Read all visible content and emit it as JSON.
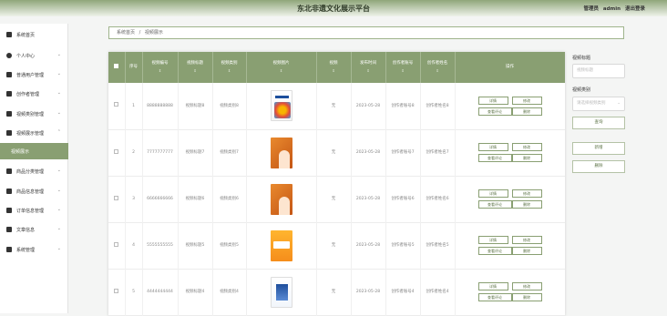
{
  "header": {
    "title": "东北非遗文化展示平台",
    "role": "管理员",
    "username": "admin",
    "logout": "退出登录"
  },
  "sidebar": {
    "items": [
      {
        "label": "系统首页",
        "icon": "home-icon",
        "chevron": ""
      },
      {
        "label": "个人中心",
        "icon": "user-icon",
        "chevron": "⌄"
      },
      {
        "label": "普通用户管理",
        "icon": "users-icon",
        "chevron": "⌄"
      },
      {
        "label": "创作者管理",
        "icon": "edit-icon",
        "chevron": "⌄"
      },
      {
        "label": "视频类别管理",
        "icon": "flag-icon",
        "chevron": "⌄"
      },
      {
        "label": "视频展示管理",
        "icon": "video-icon",
        "chevron": "⌃"
      },
      {
        "label": "视频展示",
        "icon": "",
        "chevron": ""
      },
      {
        "label": "商品分类管理",
        "icon": "grid-icon",
        "chevron": "⌄"
      },
      {
        "label": "商品信息管理",
        "icon": "bar-chart-icon",
        "chevron": "⌄"
      },
      {
        "label": "订单信息管理",
        "icon": "cart-icon",
        "chevron": "⌄"
      },
      {
        "label": "文章信息",
        "icon": "grid-icon",
        "chevron": "⌄"
      },
      {
        "label": "系统管理",
        "icon": "grid-icon",
        "chevron": "⌄"
      }
    ]
  },
  "breadcrumb": {
    "home": "系统首页",
    "sep": "/",
    "current": "视频展示"
  },
  "table": {
    "headers": [
      "序号",
      "视频编号",
      "视频标题",
      "视频类别",
      "视频图片",
      "视频",
      "发布时间",
      "创作者账号",
      "创作者姓名",
      "操作"
    ],
    "sort_mark": "⇕",
    "rows": [
      {
        "idx": "1",
        "code": "8888888888",
        "title": "视频标题8",
        "category": "视频类别8",
        "video": "无",
        "time": "2023-05-28",
        "account": "创作者账号8",
        "name": "创作者姓名8",
        "cover": "c0"
      },
      {
        "idx": "2",
        "code": "7777777777",
        "title": "视频标题7",
        "category": "视频类别7",
        "video": "无",
        "time": "2023-05-28",
        "account": "创作者账号7",
        "name": "创作者姓名7",
        "cover": "c1"
      },
      {
        "idx": "3",
        "code": "6666666666",
        "title": "视频标题6",
        "category": "视频类别6",
        "video": "无",
        "time": "2023-05-28",
        "account": "创作者账号6",
        "name": "创作者姓名6",
        "cover": "c1"
      },
      {
        "idx": "4",
        "code": "5555555555",
        "title": "视频标题5",
        "category": "视频类别5",
        "video": "无",
        "time": "2023-05-28",
        "account": "创作者账号5",
        "name": "创作者姓名5",
        "cover": "c3"
      },
      {
        "idx": "5",
        "code": "4444444444",
        "title": "视频标题4",
        "category": "视频类别4",
        "video": "无",
        "time": "2023-05-28",
        "account": "创作者账号4",
        "name": "创作者姓名4",
        "cover": "c4"
      }
    ],
    "actions": {
      "detail": "详情",
      "edit": "修改",
      "comment": "查看评论",
      "delete": "删除"
    }
  },
  "filters": {
    "title_label": "视频标题",
    "title_placeholder": "视频标题",
    "category_label": "视频类别",
    "category_placeholder": "请选择视频类别",
    "category_arrow": "⌄",
    "search": "查询",
    "add": "新增",
    "delete": "删除"
  },
  "colors": {
    "accent": "#899f72",
    "header_top": "#8fa67a"
  }
}
